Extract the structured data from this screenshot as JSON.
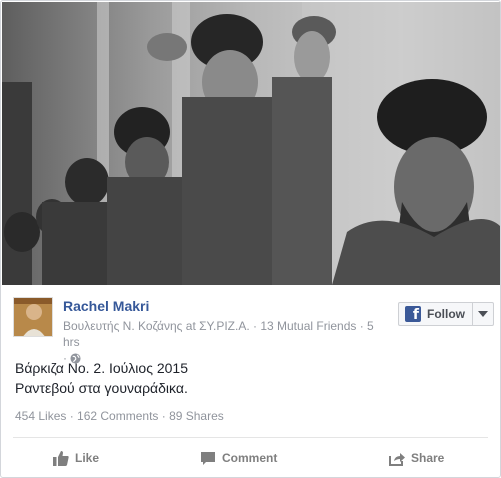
{
  "post": {
    "author": "Rachel Makri",
    "meta_line": "Βουλευτής Ν. Κοζάνης at ΣΥ.ΡΙΖ.Α. · 13 Mutual Friends · 5 hrs",
    "meta_sub": "·",
    "message_line1": "Βάρκιζα Νο. 2. Ιούλιος 2015",
    "message_line2": "Ραντεβού στα γουναράδικα."
  },
  "follow": {
    "label": "Follow"
  },
  "stats": {
    "text": "454 Likes · 162 Comments · 89 Shares"
  },
  "actions": {
    "like": "Like",
    "comment": "Comment",
    "share": "Share"
  },
  "icons": {
    "facebook": "facebook-f-icon",
    "caret": "chevron-down-icon",
    "privacy": "globe-icon",
    "like": "thumbs-up-icon",
    "comment": "speech-bubble-icon",
    "share": "share-arrow-icon"
  },
  "colors": {
    "author_link": "#365899",
    "meta": "#90949c",
    "facebook_blue": "#3b5998",
    "action_text": "#7f7f7f"
  }
}
